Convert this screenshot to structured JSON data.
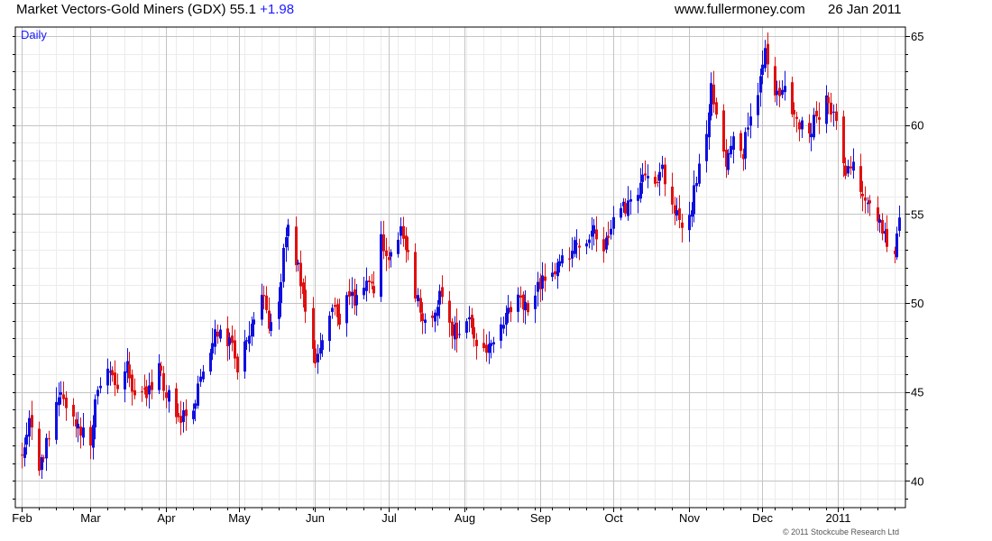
{
  "header": {
    "title": "Market Vectors-Gold Miners (GDX) 55.1",
    "change": "+1.98",
    "website": "www.fullermoney.com",
    "date": "26 Jan 2011"
  },
  "footer": {
    "copyright": "© 2011 Stockcube Research Ltd"
  },
  "colors": {
    "up": "#1010e0",
    "down": "#e01010",
    "grid": "#dcdcdc",
    "period_label": "#1a1aff"
  },
  "chart_data": {
    "type": "candlestick",
    "period_label": "Daily",
    "y_axis": {
      "min": 38.5,
      "max": 65.5,
      "ticks": [
        40,
        45,
        50,
        55,
        60,
        65
      ],
      "position": "right"
    },
    "x_axis": {
      "labels": [
        "Feb",
        "Mar",
        "Apr",
        "May",
        "Jun",
        "Jul",
        "Aug",
        "Sep",
        "Oct",
        "Nov",
        "Dec",
        "2011"
      ]
    },
    "grid": true,
    "close_path": [
      [
        "2010-02-01",
        41.5
      ],
      [
        "2010-02-04",
        43.3
      ],
      [
        "2010-02-08",
        40.6
      ],
      [
        "2010-02-12",
        42.6
      ],
      [
        "2010-02-17",
        45.1
      ],
      [
        "2010-02-23",
        43.4
      ],
      [
        "2010-03-01",
        42.0
      ],
      [
        "2010-03-03",
        44.6
      ],
      [
        "2010-03-08",
        46.5
      ],
      [
        "2010-03-12",
        45.3
      ],
      [
        "2010-03-16",
        46.3
      ],
      [
        "2010-03-19",
        44.5
      ],
      [
        "2010-03-24",
        45.0
      ],
      [
        "2010-03-29",
        46.2
      ],
      [
        "2010-04-01",
        45.0
      ],
      [
        "2010-04-06",
        43.3
      ],
      [
        "2010-04-12",
        44.2
      ],
      [
        "2010-04-16",
        46.4
      ],
      [
        "2010-04-21",
        48.3
      ],
      [
        "2010-04-27",
        47.8
      ],
      [
        "2010-04-30",
        46.4
      ],
      [
        "2010-05-03",
        47.4
      ],
      [
        "2010-05-07",
        49.3
      ],
      [
        "2010-05-11",
        50.5
      ],
      [
        "2010-05-13",
        48.5
      ],
      [
        "2010-05-17",
        50.0
      ],
      [
        "2010-05-19",
        53.0
      ],
      [
        "2010-05-21",
        54.2
      ],
      [
        "2010-05-25",
        52.0
      ],
      [
        "2010-05-28",
        49.5
      ],
      [
        "2010-06-01",
        47.0
      ],
      [
        "2010-06-04",
        47.8
      ],
      [
        "2010-06-08",
        49.8
      ],
      [
        "2010-06-11",
        49.0
      ],
      [
        "2010-06-15",
        50.5
      ],
      [
        "2010-06-18",
        50.0
      ],
      [
        "2010-06-22",
        51.2
      ],
      [
        "2010-06-25",
        50.5
      ],
      [
        "2010-06-28",
        53.5
      ],
      [
        "2010-07-01",
        52.5
      ],
      [
        "2010-07-06",
        54.0
      ],
      [
        "2010-07-09",
        52.5
      ],
      [
        "2010-07-13",
        50.0
      ],
      [
        "2010-07-16",
        48.8
      ],
      [
        "2010-07-20",
        49.6
      ],
      [
        "2010-07-23",
        50.6
      ],
      [
        "2010-07-27",
        48.5
      ],
      [
        "2010-07-30",
        48.2
      ],
      [
        "2010-08-03",
        49.3
      ],
      [
        "2010-08-06",
        48.0
      ],
      [
        "2010-08-10",
        47.2
      ],
      [
        "2010-08-13",
        48.0
      ],
      [
        "2010-08-17",
        49.2
      ],
      [
        "2010-08-20",
        49.8
      ],
      [
        "2010-08-24",
        50.2
      ],
      [
        "2010-08-27",
        49.5
      ],
      [
        "2010-08-31",
        50.8
      ],
      [
        "2010-09-03",
        51.5
      ],
      [
        "2010-09-08",
        52.0
      ],
      [
        "2010-09-13",
        52.8
      ],
      [
        "2010-09-16",
        53.5
      ],
      [
        "2010-09-20",
        53.0
      ],
      [
        "2010-09-23",
        54.0
      ],
      [
        "2010-09-27",
        52.8
      ],
      [
        "2010-09-30",
        54.5
      ],
      [
        "2010-10-04",
        55.4
      ],
      [
        "2010-10-07",
        55.5
      ],
      [
        "2010-10-11",
        56.0
      ],
      [
        "2010-10-14",
        57.2
      ],
      [
        "2010-10-18",
        56.5
      ],
      [
        "2010-10-21",
        57.4
      ],
      [
        "2010-10-26",
        55.0
      ],
      [
        "2010-10-29",
        54.3
      ],
      [
        "2010-11-02",
        55.5
      ],
      [
        "2010-11-05",
        57.5
      ],
      [
        "2010-11-08",
        59.5
      ],
      [
        "2010-11-10",
        62.0
      ],
      [
        "2010-11-12",
        60.5
      ],
      [
        "2010-11-16",
        57.8
      ],
      [
        "2010-11-19",
        59.8
      ],
      [
        "2010-11-23",
        58.5
      ],
      [
        "2010-11-26",
        60.5
      ],
      [
        "2010-11-30",
        62.5
      ],
      [
        "2010-12-02",
        64.0
      ],
      [
        "2010-12-06",
        61.5
      ],
      [
        "2010-12-09",
        62.0
      ],
      [
        "2010-12-13",
        61.0
      ],
      [
        "2010-12-16",
        60.0
      ],
      [
        "2010-12-20",
        59.5
      ],
      [
        "2010-12-23",
        60.5
      ],
      [
        "2010-12-28",
        61.5
      ],
      [
        "2010-12-31",
        60.0
      ],
      [
        "2011-01-04",
        57.5
      ],
      [
        "2011-01-07",
        58.0
      ],
      [
        "2011-01-11",
        56.0
      ],
      [
        "2011-01-14",
        55.5
      ],
      [
        "2011-01-18",
        54.5
      ],
      [
        "2011-01-21",
        53.2
      ],
      [
        "2011-01-24",
        53.1
      ],
      [
        "2011-01-26",
        55.1
      ]
    ],
    "notes": "Daily OHLC candles from Feb 2010 to 26 Jan 2011; blue = close above open, red = close below open."
  }
}
